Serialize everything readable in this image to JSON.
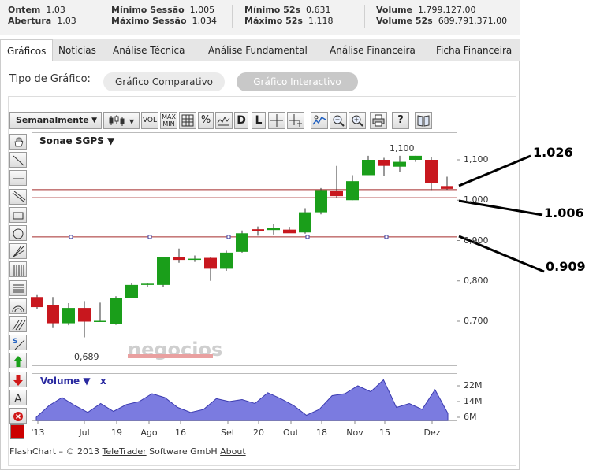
{
  "stats": {
    "col1": {
      "label1": "Ontem",
      "value1": "1,03",
      "label2": "Abertura",
      "value2": "1,03"
    },
    "col2": {
      "label1": "Mínimo Sessão",
      "value1": "1,005",
      "label2": "Máximo Sessão",
      "value2": "1,034"
    },
    "col3": {
      "label1": "Mínimo 52s",
      "value1": "0,631",
      "label2": "Máximo 52s",
      "value2": "1,118"
    },
    "col4": {
      "label1": "Volume",
      "value1": "1.799.127,00",
      "label2": "Volume 52s",
      "value2": "689.791.371,00"
    }
  },
  "tabs": [
    "Gráficos",
    "Notícias",
    "Análise Técnica",
    "Análise Fundamental",
    "Análise Financeira",
    "Ficha Financeira"
  ],
  "tipo_label": "Tipo de Gráfico:",
  "pills": {
    "comparativo": "Gráfico Comparativo",
    "interactivo": "Gráfico Interactivo"
  },
  "toolbar": {
    "period": "Semanalmente",
    "vol": "VOL",
    "maxmin": "MAX MIN",
    "pct": "%",
    "d": "D",
    "l": "L",
    "help": "?"
  },
  "left_tools": [
    "hand-tool",
    "trend-line",
    "horizontal-line",
    "parallel-lines",
    "rectangle",
    "circle",
    "fan",
    "vertical-grid",
    "horizontal-grid",
    "arcs",
    "diagonal-lines",
    "support-resistance",
    "buy-arrow",
    "sell-arrow",
    "text",
    "delete"
  ],
  "left_tool_text": {
    "a": "A",
    "s": "S"
  },
  "chart_title": "Sonae SGPS ▼",
  "volume_title": "Volume ▼",
  "volume_close": "x",
  "price_labels": [
    "1,100",
    "1,000",
    "0,900",
    "0,800",
    "0,700"
  ],
  "volume_labels": [
    "22M",
    "14M",
    "6M"
  ],
  "x_labels": [
    "'13",
    "Jul",
    "19",
    "Ago",
    "16",
    "Set",
    "20",
    "Out",
    "18",
    "Nov",
    "15",
    "Dez"
  ],
  "point_labels": {
    "high": "1,100",
    "low": "0,689"
  },
  "watermark": "negocios",
  "footer": {
    "prefix": "FlashChart – © 2013 ",
    "company": "TeleTrader",
    "middle": " Software GmbH ",
    "about": "About"
  },
  "annotations": [
    "1.026",
    "1.006",
    "0.909"
  ],
  "colors": {
    "up": "#1a9e1a",
    "down": "#c8171e",
    "volume": "#7b7be0",
    "hline": "#a52a2a"
  },
  "chart_data": {
    "type": "candlestick",
    "title": "Sonae SGPS",
    "interval": "Semanalmente",
    "ylim": [
      0.6,
      1.15
    ],
    "hlines": [
      1.026,
      1.006,
      0.909
    ],
    "candles": [
      {
        "o": 0.76,
        "h": 0.765,
        "l": 0.73,
        "c": 0.735
      },
      {
        "o": 0.74,
        "h": 0.76,
        "l": 0.685,
        "c": 0.695
      },
      {
        "o": 0.695,
        "h": 0.745,
        "l": 0.69,
        "c": 0.733
      },
      {
        "o": 0.733,
        "h": 0.75,
        "l": 0.66,
        "c": 0.699
      },
      {
        "o": 0.701,
        "h": 0.746,
        "l": 0.698,
        "c": 0.701
      },
      {
        "o": 0.693,
        "h": 0.762,
        "l": 0.691,
        "c": 0.758
      },
      {
        "o": 0.758,
        "h": 0.795,
        "l": 0.757,
        "c": 0.79
      },
      {
        "o": 0.79,
        "h": 0.795,
        "l": 0.785,
        "c": 0.793
      },
      {
        "o": 0.79,
        "h": 0.86,
        "l": 0.785,
        "c": 0.86
      },
      {
        "o": 0.86,
        "h": 0.88,
        "l": 0.845,
        "c": 0.852
      },
      {
        "o": 0.855,
        "h": 0.863,
        "l": 0.847,
        "c": 0.855
      },
      {
        "o": 0.857,
        "h": 0.86,
        "l": 0.8,
        "c": 0.83
      },
      {
        "o": 0.83,
        "h": 0.875,
        "l": 0.825,
        "c": 0.87
      },
      {
        "o": 0.872,
        "h": 0.925,
        "l": 0.87,
        "c": 0.918
      },
      {
        "o": 0.928,
        "h": 0.935,
        "l": 0.912,
        "c": 0.924
      },
      {
        "o": 0.926,
        "h": 0.94,
        "l": 0.915,
        "c": 0.932
      },
      {
        "o": 0.927,
        "h": 0.934,
        "l": 0.921,
        "c": 0.918
      },
      {
        "o": 0.92,
        "h": 0.98,
        "l": 0.917,
        "c": 0.97
      },
      {
        "o": 0.97,
        "h": 1.03,
        "l": 0.965,
        "c": 1.025
      },
      {
        "o": 1.023,
        "h": 1.085,
        "l": 1.006,
        "c": 1.01
      },
      {
        "o": 1.0,
        "h": 1.062,
        "l": 1.0,
        "c": 1.047
      },
      {
        "o": 1.062,
        "h": 1.11,
        "l": 1.062,
        "c": 1.1
      },
      {
        "o": 1.1,
        "h": 1.105,
        "l": 1.06,
        "c": 1.085
      },
      {
        "o": 1.083,
        "h": 1.11,
        "l": 1.07,
        "c": 1.095
      },
      {
        "o": 1.1,
        "h": 1.11,
        "l": 1.095,
        "c": 1.11
      },
      {
        "o": 1.1,
        "h": 1.107,
        "l": 1.025,
        "c": 1.042
      },
      {
        "o": 1.035,
        "h": 1.058,
        "l": 1.026,
        "c": 1.028
      }
    ],
    "volume_series": [
      6,
      12,
      16,
      12,
      8.5,
      13,
      9,
      12.5,
      14,
      18,
      16,
      11,
      8.5,
      10,
      15.5,
      14,
      15,
      13,
      18.5,
      15.5,
      12,
      7,
      10,
      17,
      18,
      22,
      19,
      25,
      11,
      13,
      10,
      20,
      8
    ],
    "price_ticks": [
      1.1,
      1.0,
      0.9,
      0.8,
      0.7
    ],
    "volume_ticks": [
      22,
      14,
      6
    ],
    "xlabel": "",
    "ylabel": ""
  }
}
